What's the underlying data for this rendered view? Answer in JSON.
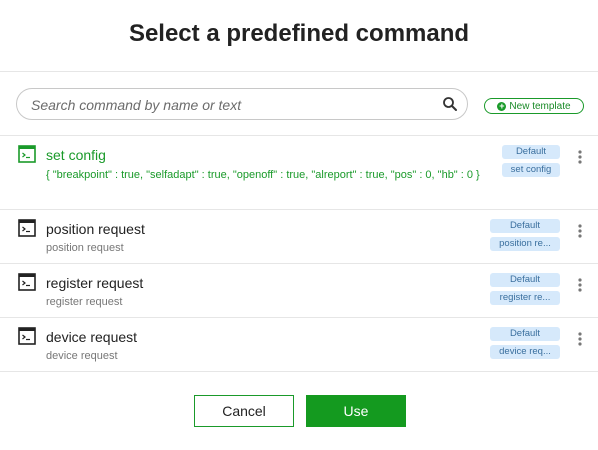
{
  "dialog": {
    "title": "Select a predefined command"
  },
  "search": {
    "placeholder": "Search command by name or text",
    "value": ""
  },
  "toolbar": {
    "new_template_label": "New template"
  },
  "commands": [
    {
      "name": "set config",
      "text": "{ \"breakpoint\" : true, \"selfadapt\" : true, \"openoff\" : true, \"alreport\" : true, \"pos\" : 0, \"hb\" : 0 }",
      "tags": [
        "Default",
        "set config"
      ],
      "selected": true
    },
    {
      "name": "position request",
      "text": "position request",
      "tags": [
        "Default",
        "position re..."
      ],
      "selected": false
    },
    {
      "name": "register request",
      "text": "register request",
      "tags": [
        "Default",
        "register re..."
      ],
      "selected": false
    },
    {
      "name": "device request",
      "text": "device request",
      "tags": [
        "Default",
        "device req..."
      ],
      "selected": false
    }
  ],
  "footer": {
    "cancel_label": "Cancel",
    "use_label": "Use"
  },
  "colors": {
    "accent": "#1a9a2a",
    "tag_bg": "#d6e9fb",
    "tag_text": "#3a6f9e"
  },
  "icons": {
    "search": "search-icon",
    "new_template": "plus-circle-icon",
    "command": "terminal-icon",
    "more": "more-vertical-icon"
  }
}
